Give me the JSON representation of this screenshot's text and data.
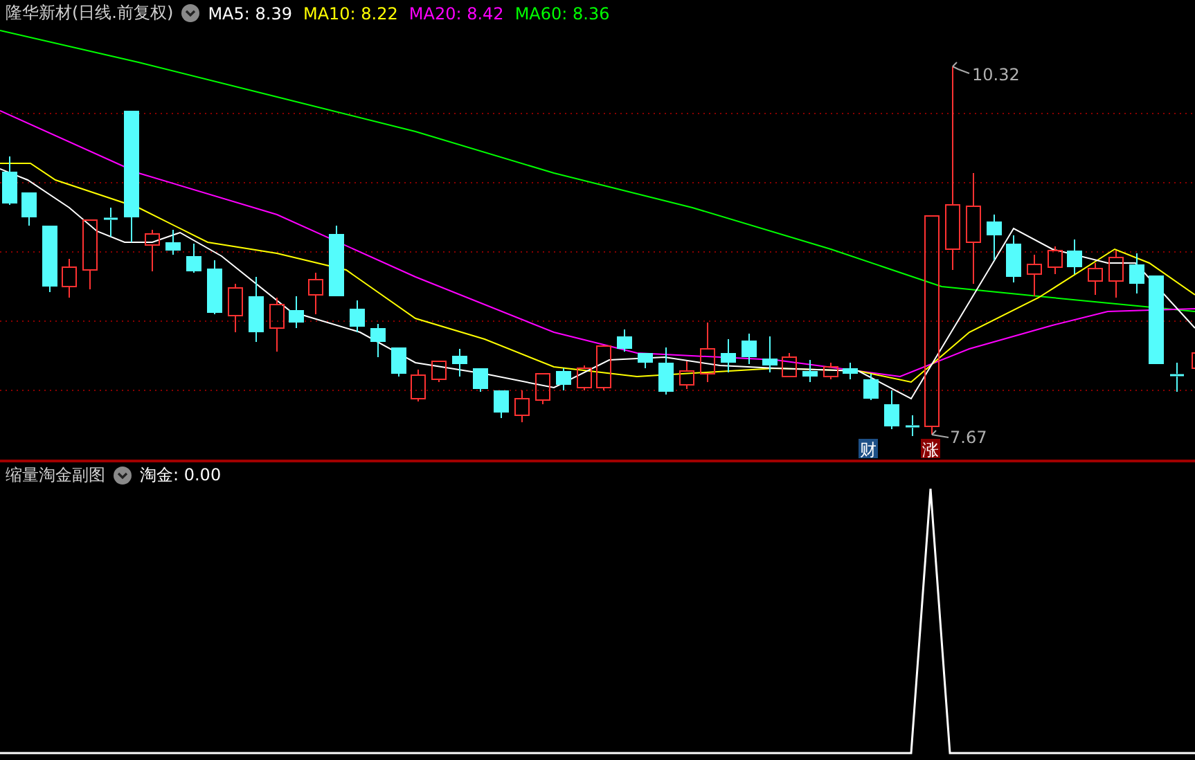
{
  "main_panel": {
    "title": "隆华新材(日线.前复权)",
    "indicators": [
      {
        "label": "MA5: 8.39",
        "color": "#ffffff"
      },
      {
        "label": "MA10: 8.22",
        "color": "#ffff00"
      },
      {
        "label": "MA20: 8.42",
        "color": "#ff00ff"
      },
      {
        "label": "MA60: 8.36",
        "color": "#00ff00"
      }
    ],
    "high_label": "10.32",
    "low_label": "7.67",
    "markers": [
      {
        "text": "财",
        "color": "#1d4f86"
      },
      {
        "text": "涨",
        "color": "#8b0000"
      }
    ]
  },
  "sub_panel": {
    "title": "缩量淘金副图",
    "indicators": [
      {
        "label": "淘金: 0.00",
        "color": "#ffffff"
      }
    ]
  }
}
